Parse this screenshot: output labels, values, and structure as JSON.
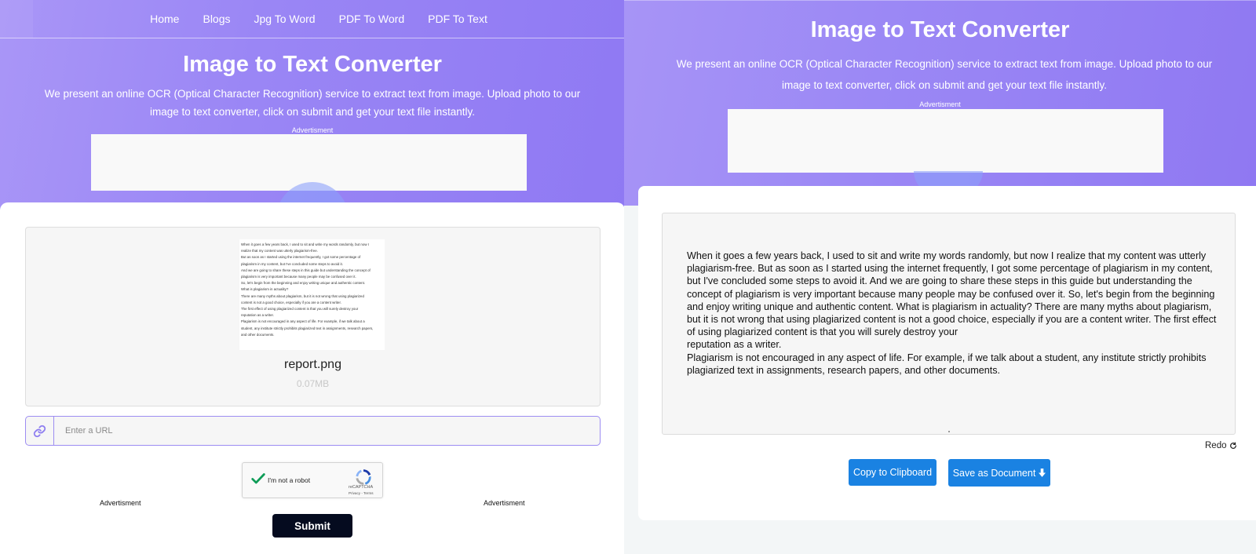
{
  "nav": {
    "items": [
      {
        "label": "Home"
      },
      {
        "label": "Blogs"
      },
      {
        "label": "Jpg To Word"
      },
      {
        "label": "PDF To Word"
      },
      {
        "label": "PDF To Text"
      }
    ]
  },
  "hero": {
    "title": "Image to Text Converter",
    "subtitle": "We present an online OCR (Optical Character Recognition) service to extract text from image. Upload photo to our image to text converter, click on submit and get your text file instantly.",
    "ad_label": "Advertisment"
  },
  "upload": {
    "thumbnail_lines": [
      "When it goes a few years back, I used to sit and write my words randomly, but now I",
      "realize that my content was utterly plagiarism-free.",
      "But as soon as I started using the internet frequently, I got some percentage of",
      "plagiarism in my content, but I've concluded some steps to avoid it.",
      "And we are going to share these steps in this guide but understanding the concept of",
      "plagiarism is very important because many people may be confused over it.",
      "So, let's begin from the beginning and enjoy writing unique and authentic content.",
      "What is plagiarism in actuality?",
      "There are many myths about plagiarism, but it is not wrong that using plagiarized",
      "content is not a good choice, especially if you are a content writer.",
      "The first effect of using plagiarized content is that you will surely destroy your",
      "reputation as a writer.",
      "Plagiarism is not encouraged in any aspect of life. For example, if we talk about a",
      "student, any institute strictly prohibits plagiarized text in assignments, research papers,",
      "and other documents."
    ],
    "file_name": "report.png",
    "file_size": "0.07MB",
    "url_placeholder": "Enter a URL",
    "link_icon": "link-icon"
  },
  "recaptcha": {
    "label": "I'm not a robot",
    "brand": "reCAPTCHA",
    "links": "Privacy - Terms",
    "checked": true
  },
  "ads": {
    "left_label": "Advertisment",
    "right_label": "Advertisment"
  },
  "submit_label": "Submit",
  "result": {
    "paragraphs": [
      "When it goes a few years back, I used to sit and write my words randomly, but now I realize that my content was utterly plagiarism-free. But as soon as I started using the internet frequently, I got some percentage of plagiarism in my content, but I've concluded some steps to avoid it. And we are going to share these steps in this guide but understanding the concept of plagiarism is very important because many people may be confused over it. So, let's begin from the beginning and enjoy writing unique and authentic content. What is plagiarism in actuality? There are many myths about plagiarism, but it is not wrong that using plagiarized content is not a good choice, especially if you are a content writer. The first effect of using plagiarized content is that you will surely destroy your",
      "reputation as a writer.",
      "Plagiarism is not encouraged in any aspect of life. For example, if we talk about a student, any institute strictly prohibits plagiarized text in assignments, research papers, and other documents."
    ],
    "redo_label": "Redo",
    "copy_label": "Copy to Clipboard",
    "save_label": "Save as Document"
  },
  "colors": {
    "hero_gradient_start": "#a996f7",
    "hero_gradient_end": "#8f79f3",
    "primary_button": "#1a82e2",
    "submit_button": "#050b1f",
    "url_border": "#9d8df2"
  }
}
